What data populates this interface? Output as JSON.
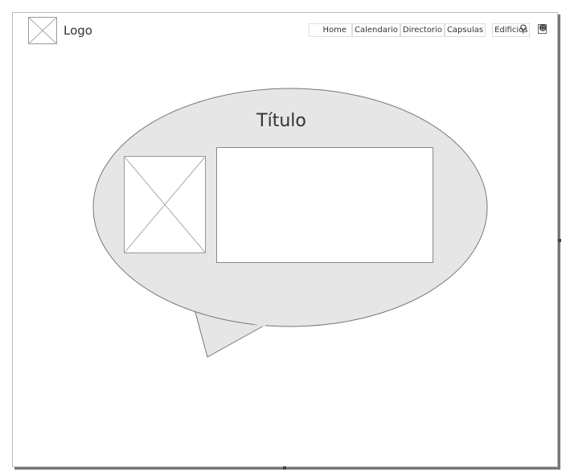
{
  "header": {
    "logo_label": "Logo",
    "nav": [
      "Home",
      "Calendario",
      "Directorio",
      "Capsulas",
      "Edificios"
    ],
    "search_icon": "search-icon",
    "user_icon": "user-icon"
  },
  "content": {
    "title": "Título",
    "image_placeholder": "image-placeholder"
  }
}
